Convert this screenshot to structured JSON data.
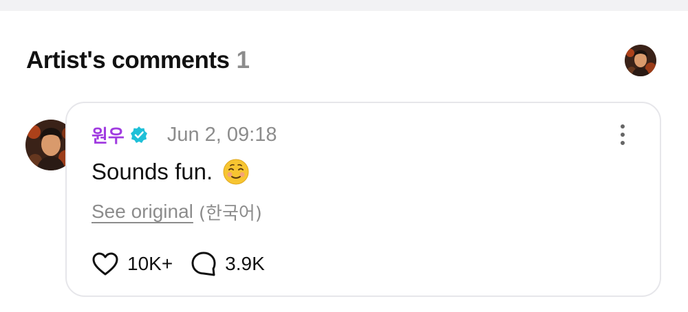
{
  "section": {
    "title": "Artist's comments",
    "count": "1"
  },
  "comment": {
    "author": "원우",
    "timestamp": "Jun 2, 09:18",
    "text": "Sounds fun.",
    "see_original": "See original",
    "language": "(한국어)",
    "likes": "10K+",
    "replies": "3.9K"
  },
  "icons": {
    "verified": "verified-badge-icon",
    "more": "more-vertical-icon",
    "like": "heart-outline-icon",
    "reply": "speech-bubble-icon",
    "emoji": "smiling-face-emoji"
  },
  "colors": {
    "author": "#a03be0",
    "verified": "#1fc0d8",
    "muted": "#8c8c8c",
    "card_border": "#e6e6ea",
    "emoji": "#f7c531"
  }
}
